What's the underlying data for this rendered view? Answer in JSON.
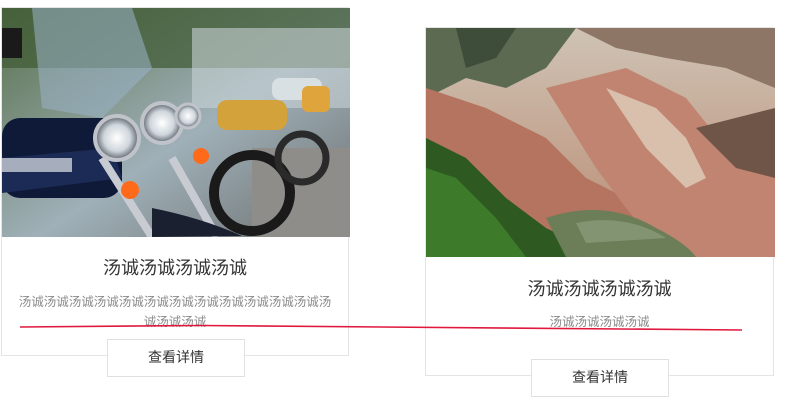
{
  "cards": [
    {
      "title": "汤诚汤诚汤诚汤诚",
      "description": "汤诚汤诚汤诚汤诚汤诚汤诚汤诚汤诚汤诚汤诚汤诚汤诚汤诚汤诚汤诚",
      "button_label": "查看详情",
      "image": "motorcycles-photo"
    },
    {
      "title": "汤诚汤诚汤诚汤诚",
      "description": "汤诚汤诚汤诚汤诚",
      "button_label": "查看详情",
      "image": "mountain-canyon-photo"
    }
  ],
  "colors": {
    "title": "#333333",
    "description": "#8a8a8a",
    "border": "#e4e4e4",
    "annotation_line": "#e0183c"
  }
}
